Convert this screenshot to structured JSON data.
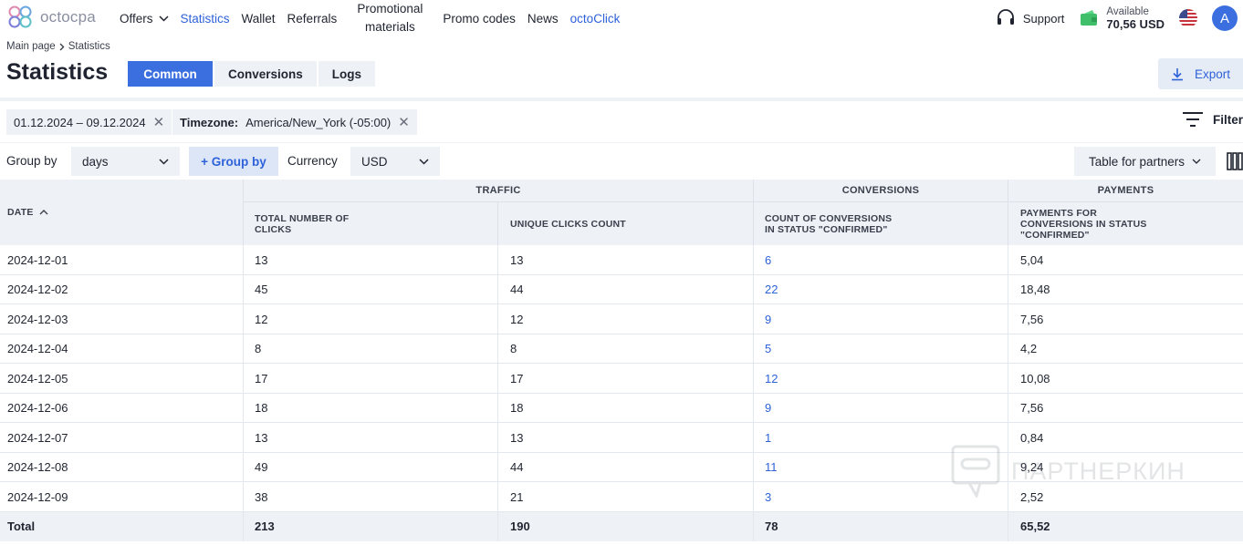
{
  "nav": {
    "logo_text": "octocpa",
    "items": [
      {
        "label": "Offers"
      },
      {
        "label": "Statistics"
      },
      {
        "label": "Wallet"
      },
      {
        "label": "Referrals"
      },
      {
        "label_line1": "Promotional",
        "label_line2": "materials"
      },
      {
        "label": "Promo codes"
      },
      {
        "label": "News"
      },
      {
        "label": "octoClick"
      }
    ],
    "support": "Support",
    "wallet_label": "Available",
    "wallet_amount": "70,56 USD",
    "avatar_initial": "A"
  },
  "breadcrumb": {
    "home": "Main page",
    "current": "Statistics"
  },
  "page": {
    "title": "Statistics",
    "tabs": [
      "Common",
      "Conversions",
      "Logs"
    ],
    "active_tab": "Common",
    "export_label": "Export"
  },
  "filters": {
    "date_range": "01.12.2024 – 09.12.2024",
    "timezone_label": "Timezone:",
    "timezone_value": "America/New_York (-05:00)",
    "filter_label": "Filter"
  },
  "controls": {
    "group_by_label": "Group by",
    "group_by_value": "days",
    "add_group_by": "+ Group by",
    "currency_label": "Currency",
    "currency_value": "USD",
    "view_select": "Table for partners"
  },
  "table": {
    "groups": {
      "traffic": "TRAFFIC",
      "conversions": "CONVERSIONS",
      "payments": "PAYMENTS"
    },
    "columns": {
      "date": "DATE",
      "total_clicks_1": "TOTAL NUMBER OF",
      "total_clicks_2": "CLICKS",
      "unique_clicks": "UNIQUE CLICKS COUNT",
      "conv_1": "COUNT OF CONVERSIONS",
      "conv_2": "IN STATUS \"CONFIRMED\"",
      "pay_1": "PAYMENTS FOR",
      "pay_2": "CONVERSIONS IN STATUS",
      "pay_3": "\"CONFIRMED\""
    },
    "rows": [
      {
        "date": "2024-12-01",
        "total": "13",
        "unique": "13",
        "conv": "6",
        "pay": "5,04"
      },
      {
        "date": "2024-12-02",
        "total": "45",
        "unique": "44",
        "conv": "22",
        "pay": "18,48"
      },
      {
        "date": "2024-12-03",
        "total": "12",
        "unique": "12",
        "conv": "9",
        "pay": "7,56"
      },
      {
        "date": "2024-12-04",
        "total": "8",
        "unique": "8",
        "conv": "5",
        "pay": "4,2"
      },
      {
        "date": "2024-12-05",
        "total": "17",
        "unique": "17",
        "conv": "12",
        "pay": "10,08"
      },
      {
        "date": "2024-12-06",
        "total": "18",
        "unique": "18",
        "conv": "9",
        "pay": "7,56"
      },
      {
        "date": "2024-12-07",
        "total": "13",
        "unique": "13",
        "conv": "1",
        "pay": "0,84"
      },
      {
        "date": "2024-12-08",
        "total": "49",
        "unique": "44",
        "conv": "11",
        "pay": "9,24"
      },
      {
        "date": "2024-12-09",
        "total": "38",
        "unique": "21",
        "conv": "3",
        "pay": "2,52"
      }
    ],
    "totals": {
      "label": "Total",
      "total": "213",
      "unique": "190",
      "conv": "78",
      "pay": "65,52"
    }
  },
  "watermark": "ПАРТНЕРКИН",
  "colors": {
    "accent": "#3b6fe0",
    "link": "#2e62d9",
    "panel": "#eef1f6"
  }
}
